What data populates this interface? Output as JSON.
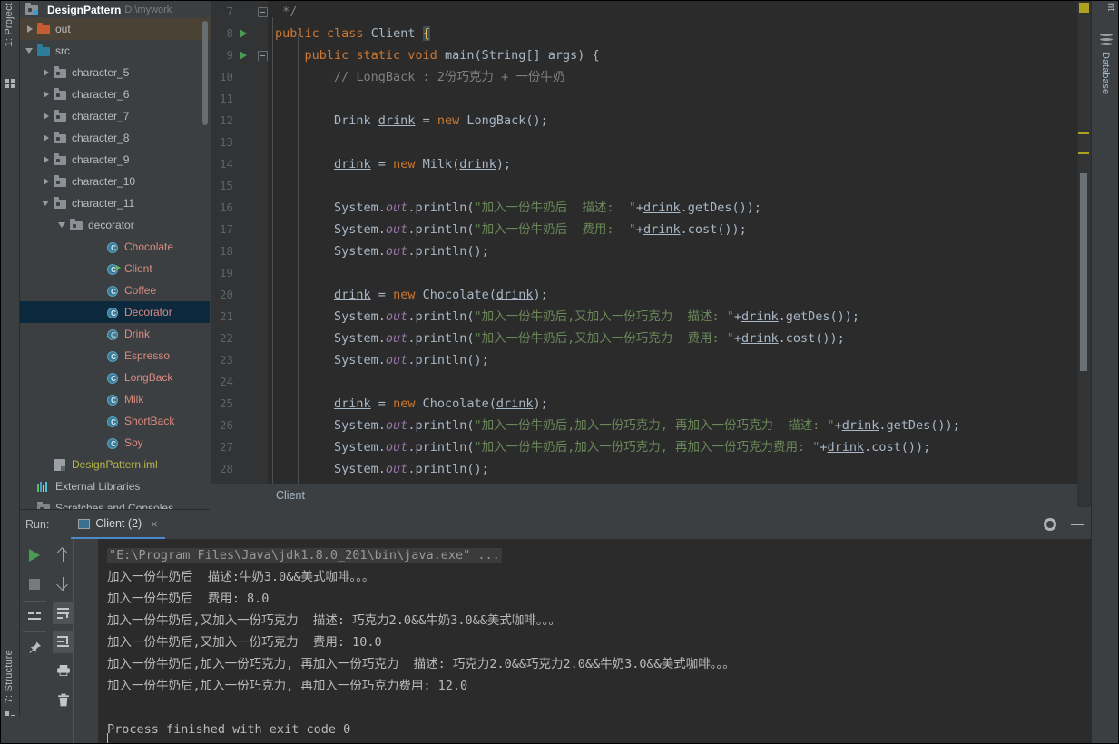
{
  "left_strip": {
    "project_tab": "1: Project",
    "structure_tab": "7: Structure"
  },
  "right_strip": {
    "top_tab": "nt",
    "database_tab": "Database"
  },
  "project": {
    "title": "DesignPattern",
    "path": "D:\\mywork",
    "tree": [
      {
        "label": "out",
        "indent": 1,
        "arrow": "right",
        "icon": "folder-orange",
        "color": "white",
        "state": "highlight"
      },
      {
        "label": "src",
        "indent": 1,
        "arrow": "down",
        "icon": "folder-blue",
        "color": "white",
        "state": "none"
      },
      {
        "label": "character_5",
        "indent": 2,
        "arrow": "right",
        "icon": "folder-grey",
        "color": "white",
        "state": "none"
      },
      {
        "label": "character_6",
        "indent": 2,
        "arrow": "right",
        "icon": "folder-grey",
        "color": "white",
        "state": "none"
      },
      {
        "label": "character_7",
        "indent": 2,
        "arrow": "right",
        "icon": "folder-grey",
        "color": "white",
        "state": "none"
      },
      {
        "label": "character_8",
        "indent": 2,
        "arrow": "right",
        "icon": "folder-grey",
        "color": "white",
        "state": "none"
      },
      {
        "label": "character_9",
        "indent": 2,
        "arrow": "right",
        "icon": "folder-grey",
        "color": "white",
        "state": "none"
      },
      {
        "label": "character_10",
        "indent": 2,
        "arrow": "right",
        "icon": "folder-grey",
        "color": "white",
        "state": "none"
      },
      {
        "label": "character_11",
        "indent": 2,
        "arrow": "down",
        "icon": "folder-grey",
        "color": "white",
        "state": "none"
      },
      {
        "label": "decorator",
        "indent": 3,
        "arrow": "down",
        "icon": "folder-grey",
        "color": "white",
        "state": "none"
      },
      {
        "label": "Chocolate",
        "indent": 5,
        "arrow": "none",
        "icon": "class",
        "color": "red",
        "state": "none"
      },
      {
        "label": "Client",
        "indent": 5,
        "arrow": "none",
        "icon": "class-runnable",
        "color": "red",
        "state": "none"
      },
      {
        "label": "Coffee",
        "indent": 5,
        "arrow": "none",
        "icon": "class",
        "color": "red",
        "state": "none"
      },
      {
        "label": "Decorator",
        "indent": 5,
        "arrow": "none",
        "icon": "class",
        "color": "red",
        "state": "selected"
      },
      {
        "label": "Drink",
        "indent": 5,
        "arrow": "none",
        "icon": "interface",
        "color": "red",
        "state": "none"
      },
      {
        "label": "Espresso",
        "indent": 5,
        "arrow": "none",
        "icon": "class",
        "color": "red",
        "state": "none"
      },
      {
        "label": "LongBack",
        "indent": 5,
        "arrow": "none",
        "icon": "class",
        "color": "red",
        "state": "none"
      },
      {
        "label": "Milk",
        "indent": 5,
        "arrow": "none",
        "icon": "class",
        "color": "red",
        "state": "none"
      },
      {
        "label": "ShortBack",
        "indent": 5,
        "arrow": "none",
        "icon": "class",
        "color": "red",
        "state": "none"
      },
      {
        "label": "Soy",
        "indent": 5,
        "arrow": "none",
        "icon": "class",
        "color": "red",
        "state": "none"
      },
      {
        "label": "DesignPattern.iml",
        "indent": 2,
        "arrow": "none",
        "icon": "iml",
        "color": "yellow",
        "state": "none"
      },
      {
        "label": "External Libraries",
        "indent": 1,
        "arrow": "none",
        "icon": "library",
        "color": "white",
        "state": "none"
      },
      {
        "label": "Scratches and Consoles",
        "indent": 1,
        "arrow": "none",
        "icon": "scratch",
        "color": "white",
        "state": "none"
      }
    ]
  },
  "editor": {
    "breadcrumb": "Client",
    "lines": [
      {
        "n": 7,
        "marker": false,
        "fold": "close",
        "tokens": [
          {
            "t": "cmt",
            "v": " */"
          }
        ]
      },
      {
        "n": 8,
        "marker": true,
        "fold": "none",
        "tokens": [
          {
            "t": "kw",
            "v": "public "
          },
          {
            "t": "kw",
            "v": "class "
          },
          {
            "t": "cls",
            "v": "Client "
          },
          {
            "t": "cursor",
            "v": "{"
          }
        ]
      },
      {
        "n": 9,
        "marker": true,
        "fold": "open",
        "tokens": [
          {
            "t": "plain",
            "v": "    "
          },
          {
            "t": "kw",
            "v": "public static void "
          },
          {
            "t": "plain",
            "v": "main(String[] args) {"
          }
        ]
      },
      {
        "n": 10,
        "marker": false,
        "fold": "none",
        "tokens": [
          {
            "t": "cmt",
            "v": "        // LongBack : 2份巧克力 + 一份牛奶"
          }
        ]
      },
      {
        "n": 11,
        "marker": false,
        "fold": "none",
        "tokens": []
      },
      {
        "n": 12,
        "marker": false,
        "fold": "none",
        "tokens": [
          {
            "t": "plain",
            "v": "        Drink "
          },
          {
            "t": "varu",
            "v": "drink"
          },
          {
            "t": "plain",
            "v": " = "
          },
          {
            "t": "kw",
            "v": "new "
          },
          {
            "t": "plain",
            "v": "LongBack();"
          }
        ]
      },
      {
        "n": 13,
        "marker": false,
        "fold": "none",
        "tokens": []
      },
      {
        "n": 14,
        "marker": false,
        "fold": "none",
        "tokens": [
          {
            "t": "plain",
            "v": "        "
          },
          {
            "t": "varu",
            "v": "drink"
          },
          {
            "t": "plain",
            "v": " = "
          },
          {
            "t": "kw",
            "v": "new "
          },
          {
            "t": "plain",
            "v": "Milk("
          },
          {
            "t": "varu",
            "v": "drink"
          },
          {
            "t": "plain",
            "v": ");"
          }
        ]
      },
      {
        "n": 15,
        "marker": false,
        "fold": "none",
        "tokens": []
      },
      {
        "n": 16,
        "marker": false,
        "fold": "none",
        "tokens": [
          {
            "t": "plain",
            "v": "        System."
          },
          {
            "t": "fld",
            "v": "out"
          },
          {
            "t": "plain",
            "v": ".println("
          },
          {
            "t": "str",
            "v": "\"加入一份牛奶后  描述:  \""
          },
          {
            "t": "plain",
            "v": "+"
          },
          {
            "t": "varu",
            "v": "drink"
          },
          {
            "t": "plain",
            "v": ".getDes());"
          }
        ]
      },
      {
        "n": 17,
        "marker": false,
        "fold": "none",
        "tokens": [
          {
            "t": "plain",
            "v": "        System."
          },
          {
            "t": "fld",
            "v": "out"
          },
          {
            "t": "plain",
            "v": ".println("
          },
          {
            "t": "str",
            "v": "\"加入一份牛奶后  费用:  \""
          },
          {
            "t": "plain",
            "v": "+"
          },
          {
            "t": "varu",
            "v": "drink"
          },
          {
            "t": "plain",
            "v": ".cost());"
          }
        ]
      },
      {
        "n": 18,
        "marker": false,
        "fold": "none",
        "tokens": [
          {
            "t": "plain",
            "v": "        System."
          },
          {
            "t": "fld",
            "v": "out"
          },
          {
            "t": "plain",
            "v": ".println();"
          }
        ]
      },
      {
        "n": 19,
        "marker": false,
        "fold": "none",
        "tokens": []
      },
      {
        "n": 20,
        "marker": false,
        "fold": "none",
        "tokens": [
          {
            "t": "plain",
            "v": "        "
          },
          {
            "t": "varu",
            "v": "drink"
          },
          {
            "t": "plain",
            "v": " = "
          },
          {
            "t": "kw",
            "v": "new "
          },
          {
            "t": "plain",
            "v": "Chocolate("
          },
          {
            "t": "varu",
            "v": "drink"
          },
          {
            "t": "plain",
            "v": ");"
          }
        ]
      },
      {
        "n": 21,
        "marker": false,
        "fold": "none",
        "tokens": [
          {
            "t": "plain",
            "v": "        System."
          },
          {
            "t": "fld",
            "v": "out"
          },
          {
            "t": "plain",
            "v": ".println("
          },
          {
            "t": "str",
            "v": "\"加入一份牛奶后,又加入一份巧克力  描述: \""
          },
          {
            "t": "plain",
            "v": "+"
          },
          {
            "t": "varu",
            "v": "drink"
          },
          {
            "t": "plain",
            "v": ".getDes());"
          }
        ]
      },
      {
        "n": 22,
        "marker": false,
        "fold": "none",
        "tokens": [
          {
            "t": "plain",
            "v": "        System."
          },
          {
            "t": "fld",
            "v": "out"
          },
          {
            "t": "plain",
            "v": ".println("
          },
          {
            "t": "str",
            "v": "\"加入一份牛奶后,又加入一份巧克力  费用: \""
          },
          {
            "t": "plain",
            "v": "+"
          },
          {
            "t": "varu",
            "v": "drink"
          },
          {
            "t": "plain",
            "v": ".cost());"
          }
        ]
      },
      {
        "n": 23,
        "marker": false,
        "fold": "none",
        "tokens": [
          {
            "t": "plain",
            "v": "        System."
          },
          {
            "t": "fld",
            "v": "out"
          },
          {
            "t": "plain",
            "v": ".println();"
          }
        ]
      },
      {
        "n": 24,
        "marker": false,
        "fold": "none",
        "tokens": []
      },
      {
        "n": 25,
        "marker": false,
        "fold": "none",
        "tokens": [
          {
            "t": "plain",
            "v": "        "
          },
          {
            "t": "varu",
            "v": "drink"
          },
          {
            "t": "plain",
            "v": " = "
          },
          {
            "t": "kw",
            "v": "new "
          },
          {
            "t": "plain",
            "v": "Chocolate("
          },
          {
            "t": "varu",
            "v": "drink"
          },
          {
            "t": "plain",
            "v": ");"
          }
        ]
      },
      {
        "n": 26,
        "marker": false,
        "fold": "none",
        "tokens": [
          {
            "t": "plain",
            "v": "        System."
          },
          {
            "t": "fld",
            "v": "out"
          },
          {
            "t": "plain",
            "v": ".println("
          },
          {
            "t": "str",
            "v": "\"加入一份牛奶后,加入一份巧克力, 再加入一份巧克力  描述: \""
          },
          {
            "t": "plain",
            "v": "+"
          },
          {
            "t": "varu",
            "v": "drink"
          },
          {
            "t": "plain",
            "v": ".getDes());"
          }
        ]
      },
      {
        "n": 27,
        "marker": false,
        "fold": "none",
        "tokens": [
          {
            "t": "plain",
            "v": "        System."
          },
          {
            "t": "fld",
            "v": "out"
          },
          {
            "t": "plain",
            "v": ".println("
          },
          {
            "t": "str",
            "v": "\"加入一份牛奶后,加入一份巧克力, 再加入一份巧克力费用: \""
          },
          {
            "t": "plain",
            "v": "+"
          },
          {
            "t": "varu",
            "v": "drink"
          },
          {
            "t": "plain",
            "v": ".cost());"
          }
        ]
      },
      {
        "n": 28,
        "marker": false,
        "fold": "none",
        "tokens": [
          {
            "t": "plain",
            "v": "        System."
          },
          {
            "t": "fld",
            "v": "out"
          },
          {
            "t": "plain",
            "v": ".println();"
          }
        ]
      }
    ]
  },
  "run_window": {
    "label": "Run:",
    "tab_title": "Client (2)",
    "close_label": "×",
    "toolbar": [
      {
        "name": "rerun-button",
        "icon": "play-triangle"
      },
      {
        "name": "stop-button",
        "icon": "stop-square"
      },
      {
        "name": "restore-layout-button",
        "icon": "layout"
      },
      {
        "name": "pin-tab-button",
        "icon": "pin"
      },
      {
        "name": "up-stacktrace-button",
        "icon": "arrow-up"
      },
      {
        "name": "down-stacktrace-button",
        "icon": "arrow-down"
      },
      {
        "name": "soft-wrap-button",
        "icon": "soft-wrap"
      },
      {
        "name": "scroll-to-end-button",
        "icon": "scroll-end"
      },
      {
        "name": "print-button",
        "icon": "printer"
      },
      {
        "name": "clear-all-button",
        "icon": "trash"
      }
    ],
    "console": [
      {
        "type": "command",
        "text": "\"E:\\Program Files\\Java\\jdk1.8.0_201\\bin\\java.exe\" ..."
      },
      {
        "type": "out",
        "text": "加入一份牛奶后  描述:牛奶3.0&&美式咖啡。。。"
      },
      {
        "type": "out",
        "text": "加入一份牛奶后  费用: 8.0"
      },
      {
        "type": "out",
        "text": "加入一份牛奶后,又加入一份巧克力  描述: 巧克力2.0&&牛奶3.0&&美式咖啡。。。"
      },
      {
        "type": "out",
        "text": "加入一份牛奶后,又加入一份巧克力  费用: 10.0"
      },
      {
        "type": "out",
        "text": "加入一份牛奶后,加入一份巧克力, 再加入一份巧克力  描述: 巧克力2.0&&巧克力2.0&&牛奶3.0&&美式咖啡。。。"
      },
      {
        "type": "out",
        "text": "加入一份牛奶后,加入一份巧克力, 再加入一份巧克力费用: 12.0"
      },
      {
        "type": "blank",
        "text": ""
      },
      {
        "type": "out",
        "text": "Process finished with exit code 0"
      }
    ]
  },
  "colors": {
    "editor_bg": "#2b2b2b",
    "panel_bg": "#3c3f41",
    "gutter_bg": "#313335",
    "keyword": "#cc7832",
    "string": "#6a8759",
    "comment": "#808080",
    "field": "#9876aa",
    "number": "#6897bb",
    "text": "#a9b7c6",
    "selection": "#0d293e",
    "tab_underline": "#4a88c7",
    "run_green": "#499c54"
  }
}
